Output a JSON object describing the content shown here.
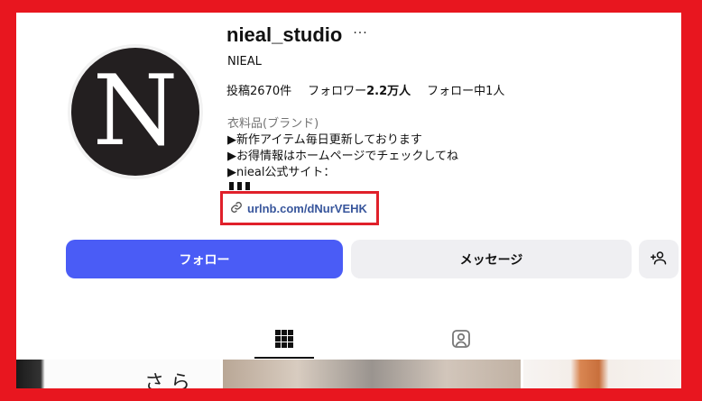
{
  "profile": {
    "username": "nieal_studio",
    "more_label": "···",
    "display_name": "NIEAL",
    "avatar_letter": "N",
    "stats": {
      "posts": "投稿2670件",
      "followers_prefix": "フォロワー",
      "followers_count": "2.2万人",
      "following": "フォロー中1人"
    },
    "category": "衣料品(ブランド)",
    "bio_lines": [
      "▶新作アイテム毎日更新しております",
      "▶お得情報はホームページでチェックしてね",
      "▶nieal公式サイト："
    ],
    "link": "urlnb.com/dNurVEHK",
    "highlight_color": "#e0202a"
  },
  "actions": {
    "follow": "フォロー",
    "message": "メッセージ",
    "add_user_icon": "person-add-icon"
  },
  "tabs": {
    "posts_icon": "grid-icon",
    "tagged_icon": "tagged-person-icon"
  },
  "colors": {
    "follow_button": "#4a5cf6",
    "secondary_button": "#efeff2",
    "link_text": "#38569c",
    "background_frame": "#e8161f"
  }
}
